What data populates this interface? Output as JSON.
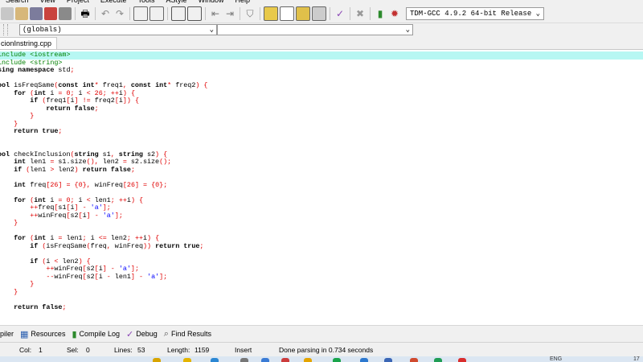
{
  "menu": [
    "Search",
    "View",
    "Project",
    "Execute",
    "Tools",
    "AStyle",
    "Window",
    "Help"
  ],
  "toolbar": {
    "compiler": "TDM-GCC 4.9.2 64-bit Release",
    "icons": [
      "new-icon",
      "open-icon",
      "save-icon",
      "save-all-icon",
      "close-icon",
      "print-icon",
      "undo-icon",
      "redo-icon",
      "find-icon",
      "replace-icon",
      "goto-icon",
      "toggle-icon",
      "indent-icon",
      "unindent-icon",
      "bookmark-icon",
      "compile-icon",
      "run-icon",
      "compile-run-icon",
      "rebuild-icon",
      "check-icon",
      "stop-icon",
      "chart-icon",
      "debug-icon"
    ]
  },
  "class_browser": {
    "scope": "(globals)",
    "member": ""
  },
  "editor": {
    "file_tab": "cionInstring.cpp",
    "lines": [
      "include <iostream>",
      "include <string>",
      "sing namespace std;",
      "",
      "ool isFreqSame(const int* freq1, const int* freq2) {",
      "    for (int i = 0; i < 26; ++i) {",
      "        if (freq1[i] != freq2[i]) {",
      "            return false;",
      "        }",
      "    }",
      "    return true;",
      "",
      "",
      "ool checkInclusion(string s1, string s2) {",
      "    int len1 = s1.size(), len2 = s2.size();",
      "    if (len1 > len2) return false;",
      "",
      "    int freq[26] = {0}, winFreq[26] = {0};",
      "",
      "    for (int i = 0; i < len1; ++i) {",
      "        ++freq[s1[i] - 'a'];",
      "        ++winFreq[s2[i] - 'a'];",
      "    }",
      "",
      "    for (int i = len1; i <= len2; ++i) {",
      "        if (isFreqSame(freq, winFreq)) return true;",
      "",
      "        if (i < len2) {",
      "            ++winFreq[s2[i] - 'a'];",
      "            --winFreq[s2[i - len1] - 'a'];",
      "        }",
      "    }",
      "",
      "    return false;"
    ]
  },
  "message_tabs": [
    {
      "label": "piler",
      "icon": ""
    },
    {
      "label": "Resources",
      "icon": "resources-icon"
    },
    {
      "label": "Compile Log",
      "icon": "compile-log-icon"
    },
    {
      "label": "Debug",
      "icon": "debug-check-icon"
    },
    {
      "label": "Find Results",
      "icon": "find-results-icon"
    }
  ],
  "status": {
    "col_label": "Col:",
    "col_value": "1",
    "sel_label": "Sel:",
    "sel_value": "0",
    "lines_label": "Lines:",
    "lines_value": "53",
    "length_label": "Length:",
    "length_value": "1159",
    "mode": "Insert",
    "message": "Done parsing in 0.734 seconds"
  },
  "taskbar": {
    "lang": "ENG",
    "clock": "17"
  },
  "colors": {
    "keyword": "#000000",
    "number": "#e00000",
    "string": "#0000ff",
    "preprocessor": "#008000",
    "active_line": "#b7f7f3"
  }
}
